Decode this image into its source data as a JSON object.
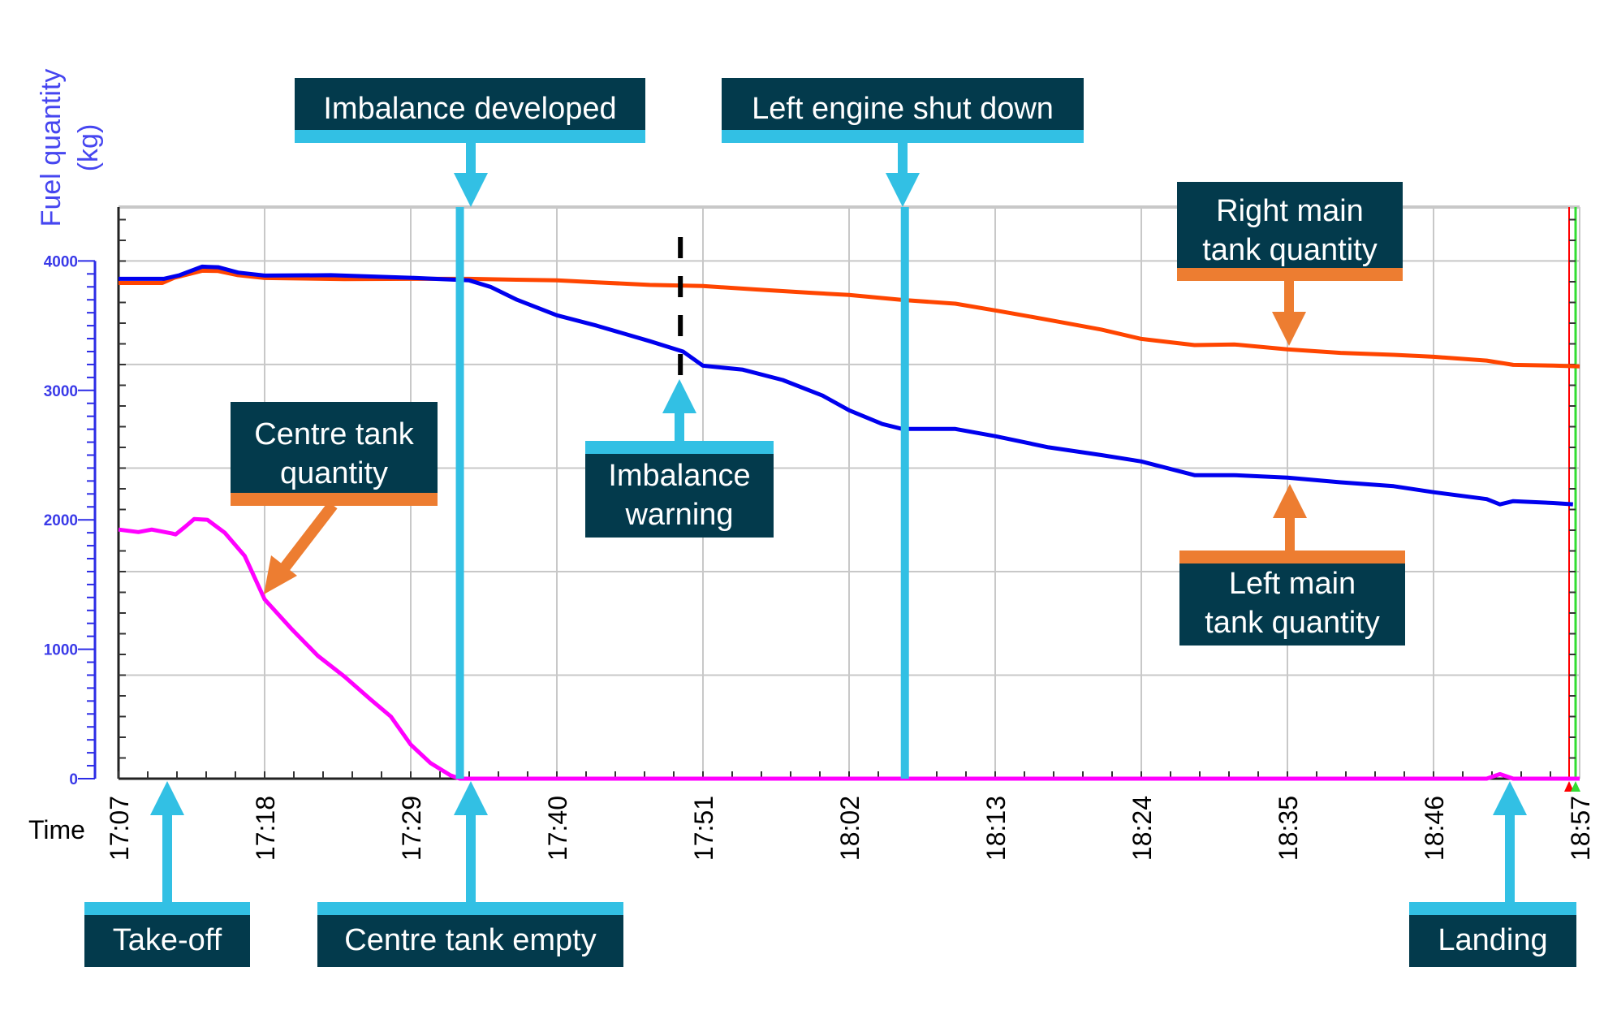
{
  "chart_data": {
    "type": "line",
    "title": "",
    "xlabel": "Time",
    "ylabel": "Fuel quantity (kg)",
    "ylim": [
      0,
      4400
    ],
    "xlim_minutes": [
      0,
      110
    ],
    "x_start_time": "17:07",
    "x_ticks": [
      "17:07",
      "17:18",
      "17:29",
      "17:40",
      "17:51",
      "18:02",
      "18:13",
      "18:24",
      "18:35",
      "18:46",
      "18:57"
    ],
    "x_tick_minutes": [
      0,
      11,
      22,
      33,
      44,
      55,
      66,
      77,
      88,
      99,
      110
    ],
    "y_ticks": [
      0,
      1000,
      2000,
      3000,
      4000
    ],
    "y_gridlines": [
      0,
      800,
      1600,
      2400,
      3200,
      4000
    ],
    "grid": true,
    "series": [
      {
        "name": "Right main tank quantity",
        "color": "#ff4500",
        "points": [
          [
            0,
            3830
          ],
          [
            3.3,
            3830
          ],
          [
            4.2,
            3870
          ],
          [
            6.3,
            3925
          ],
          [
            7.5,
            3922
          ],
          [
            9,
            3890
          ],
          [
            11,
            3868
          ],
          [
            17,
            3860
          ],
          [
            22,
            3862
          ],
          [
            26.4,
            3862
          ],
          [
            30,
            3855
          ],
          [
            33,
            3850
          ],
          [
            36,
            3835
          ],
          [
            40,
            3815
          ],
          [
            44,
            3806
          ],
          [
            48,
            3780
          ],
          [
            52,
            3755
          ],
          [
            55,
            3737
          ],
          [
            59,
            3699
          ],
          [
            63,
            3670
          ],
          [
            66,
            3618
          ],
          [
            70,
            3545
          ],
          [
            74,
            3470
          ],
          [
            77,
            3398
          ],
          [
            81,
            3350
          ],
          [
            84,
            3355
          ],
          [
            88,
            3317
          ],
          [
            92,
            3290
          ],
          [
            96,
            3275
          ],
          [
            99,
            3260
          ],
          [
            103,
            3230
          ],
          [
            105,
            3197
          ],
          [
            108,
            3192
          ],
          [
            110,
            3185
          ]
        ]
      },
      {
        "name": "Left main tank quantity",
        "color": "#0000ee",
        "points": [
          [
            0,
            3862
          ],
          [
            3.4,
            3862
          ],
          [
            4.6,
            3890
          ],
          [
            6.3,
            3956
          ],
          [
            7.5,
            3952
          ],
          [
            9,
            3910
          ],
          [
            11,
            3887
          ],
          [
            16,
            3890
          ],
          [
            22,
            3870
          ],
          [
            26.4,
            3850
          ],
          [
            28,
            3800
          ],
          [
            30,
            3700
          ],
          [
            33,
            3580
          ],
          [
            36,
            3500
          ],
          [
            40,
            3380
          ],
          [
            42.5,
            3300
          ],
          [
            44,
            3191
          ],
          [
            47,
            3160
          ],
          [
            50,
            3080
          ],
          [
            53,
            2960
          ],
          [
            55,
            2846
          ],
          [
            57.5,
            2740
          ],
          [
            59,
            2702
          ],
          [
            63,
            2702
          ],
          [
            66,
            2646
          ],
          [
            70,
            2560
          ],
          [
            74,
            2500
          ],
          [
            77,
            2451
          ],
          [
            81,
            2345
          ],
          [
            84,
            2345
          ],
          [
            88,
            2326
          ],
          [
            92,
            2290
          ],
          [
            96,
            2260
          ],
          [
            99,
            2213
          ],
          [
            103,
            2160
          ],
          [
            104,
            2119
          ],
          [
            105,
            2144
          ],
          [
            108,
            2130
          ],
          [
            109.5,
            2120
          ]
        ]
      },
      {
        "name": "Centre tank quantity",
        "color": "#ff00ff",
        "points": [
          [
            0,
            1925
          ],
          [
            1.5,
            1905
          ],
          [
            2.5,
            1925
          ],
          [
            4,
            1895
          ],
          [
            4.3,
            1887
          ],
          [
            5,
            1945
          ],
          [
            5.7,
            2006
          ],
          [
            6.7,
            2000
          ],
          [
            8,
            1900
          ],
          [
            9.5,
            1720
          ],
          [
            11,
            1385
          ],
          [
            13,
            1160
          ],
          [
            15,
            950
          ],
          [
            17,
            790
          ],
          [
            19,
            610
          ],
          [
            20.5,
            480
          ],
          [
            22,
            263
          ],
          [
            23.5,
            120
          ],
          [
            25,
            25
          ],
          [
            25.7,
            0
          ],
          [
            103,
            0
          ],
          [
            104,
            35
          ],
          [
            105,
            0
          ],
          [
            110,
            0
          ]
        ]
      }
    ],
    "annotations": [
      {
        "id": "imbalance-developed",
        "label": [
          "Imbalance developed"
        ],
        "time": "17:33",
        "minute": 25.7,
        "position": "top",
        "color": "#32c0e4"
      },
      {
        "id": "left-engine-shut-down",
        "label": [
          "Left engine shut down"
        ],
        "time": "18:06",
        "minute": 59.2,
        "position": "top",
        "color": "#32c0e4"
      },
      {
        "id": "imbalance-warning",
        "label": [
          "Imbalance",
          "warning"
        ],
        "time": "17:49",
        "minute": 42.3,
        "position": "inside",
        "color": "#32c0e4"
      },
      {
        "id": "take-off",
        "label": [
          "Take-off"
        ],
        "time": "17:11",
        "minute": 3.7,
        "position": "bottom",
        "color": "#32c0e4"
      },
      {
        "id": "centre-tank-empty",
        "label": [
          "Centre tank empty"
        ],
        "time": "17:33",
        "minute": 25.7,
        "position": "bottom",
        "color": "#32c0e4"
      },
      {
        "id": "landing",
        "label": [
          "Landing"
        ],
        "time": "18:52",
        "minute": 104.7,
        "position": "bottom",
        "color": "#32c0e4"
      },
      {
        "id": "centre-tank-quantity",
        "label": [
          "Centre tank",
          "quantity"
        ],
        "series": "Centre tank quantity",
        "color": "#ed7d31"
      },
      {
        "id": "right-main-tank-quantity",
        "label": [
          "Right main",
          "tank quantity"
        ],
        "series": "Right main tank quantity",
        "color": "#ed7d31"
      },
      {
        "id": "left-main-tank-quantity",
        "label": [
          "Left main",
          "tank quantity"
        ],
        "series": "Left main tank quantity",
        "color": "#ed7d31"
      }
    ]
  },
  "labels": {
    "ylabel_line1": "Fuel quantity",
    "ylabel_line2": "(kg)",
    "xlabel": "Time"
  },
  "colors": {
    "annotation_box": "#033a4c",
    "event_accent": "#32c0e4",
    "series_accent": "#ed7d31",
    "y_axis": "#2b2be6",
    "grid": "#c8c8c8",
    "end_marker_red": "#ff0000",
    "end_marker_green": "#33dd33"
  }
}
